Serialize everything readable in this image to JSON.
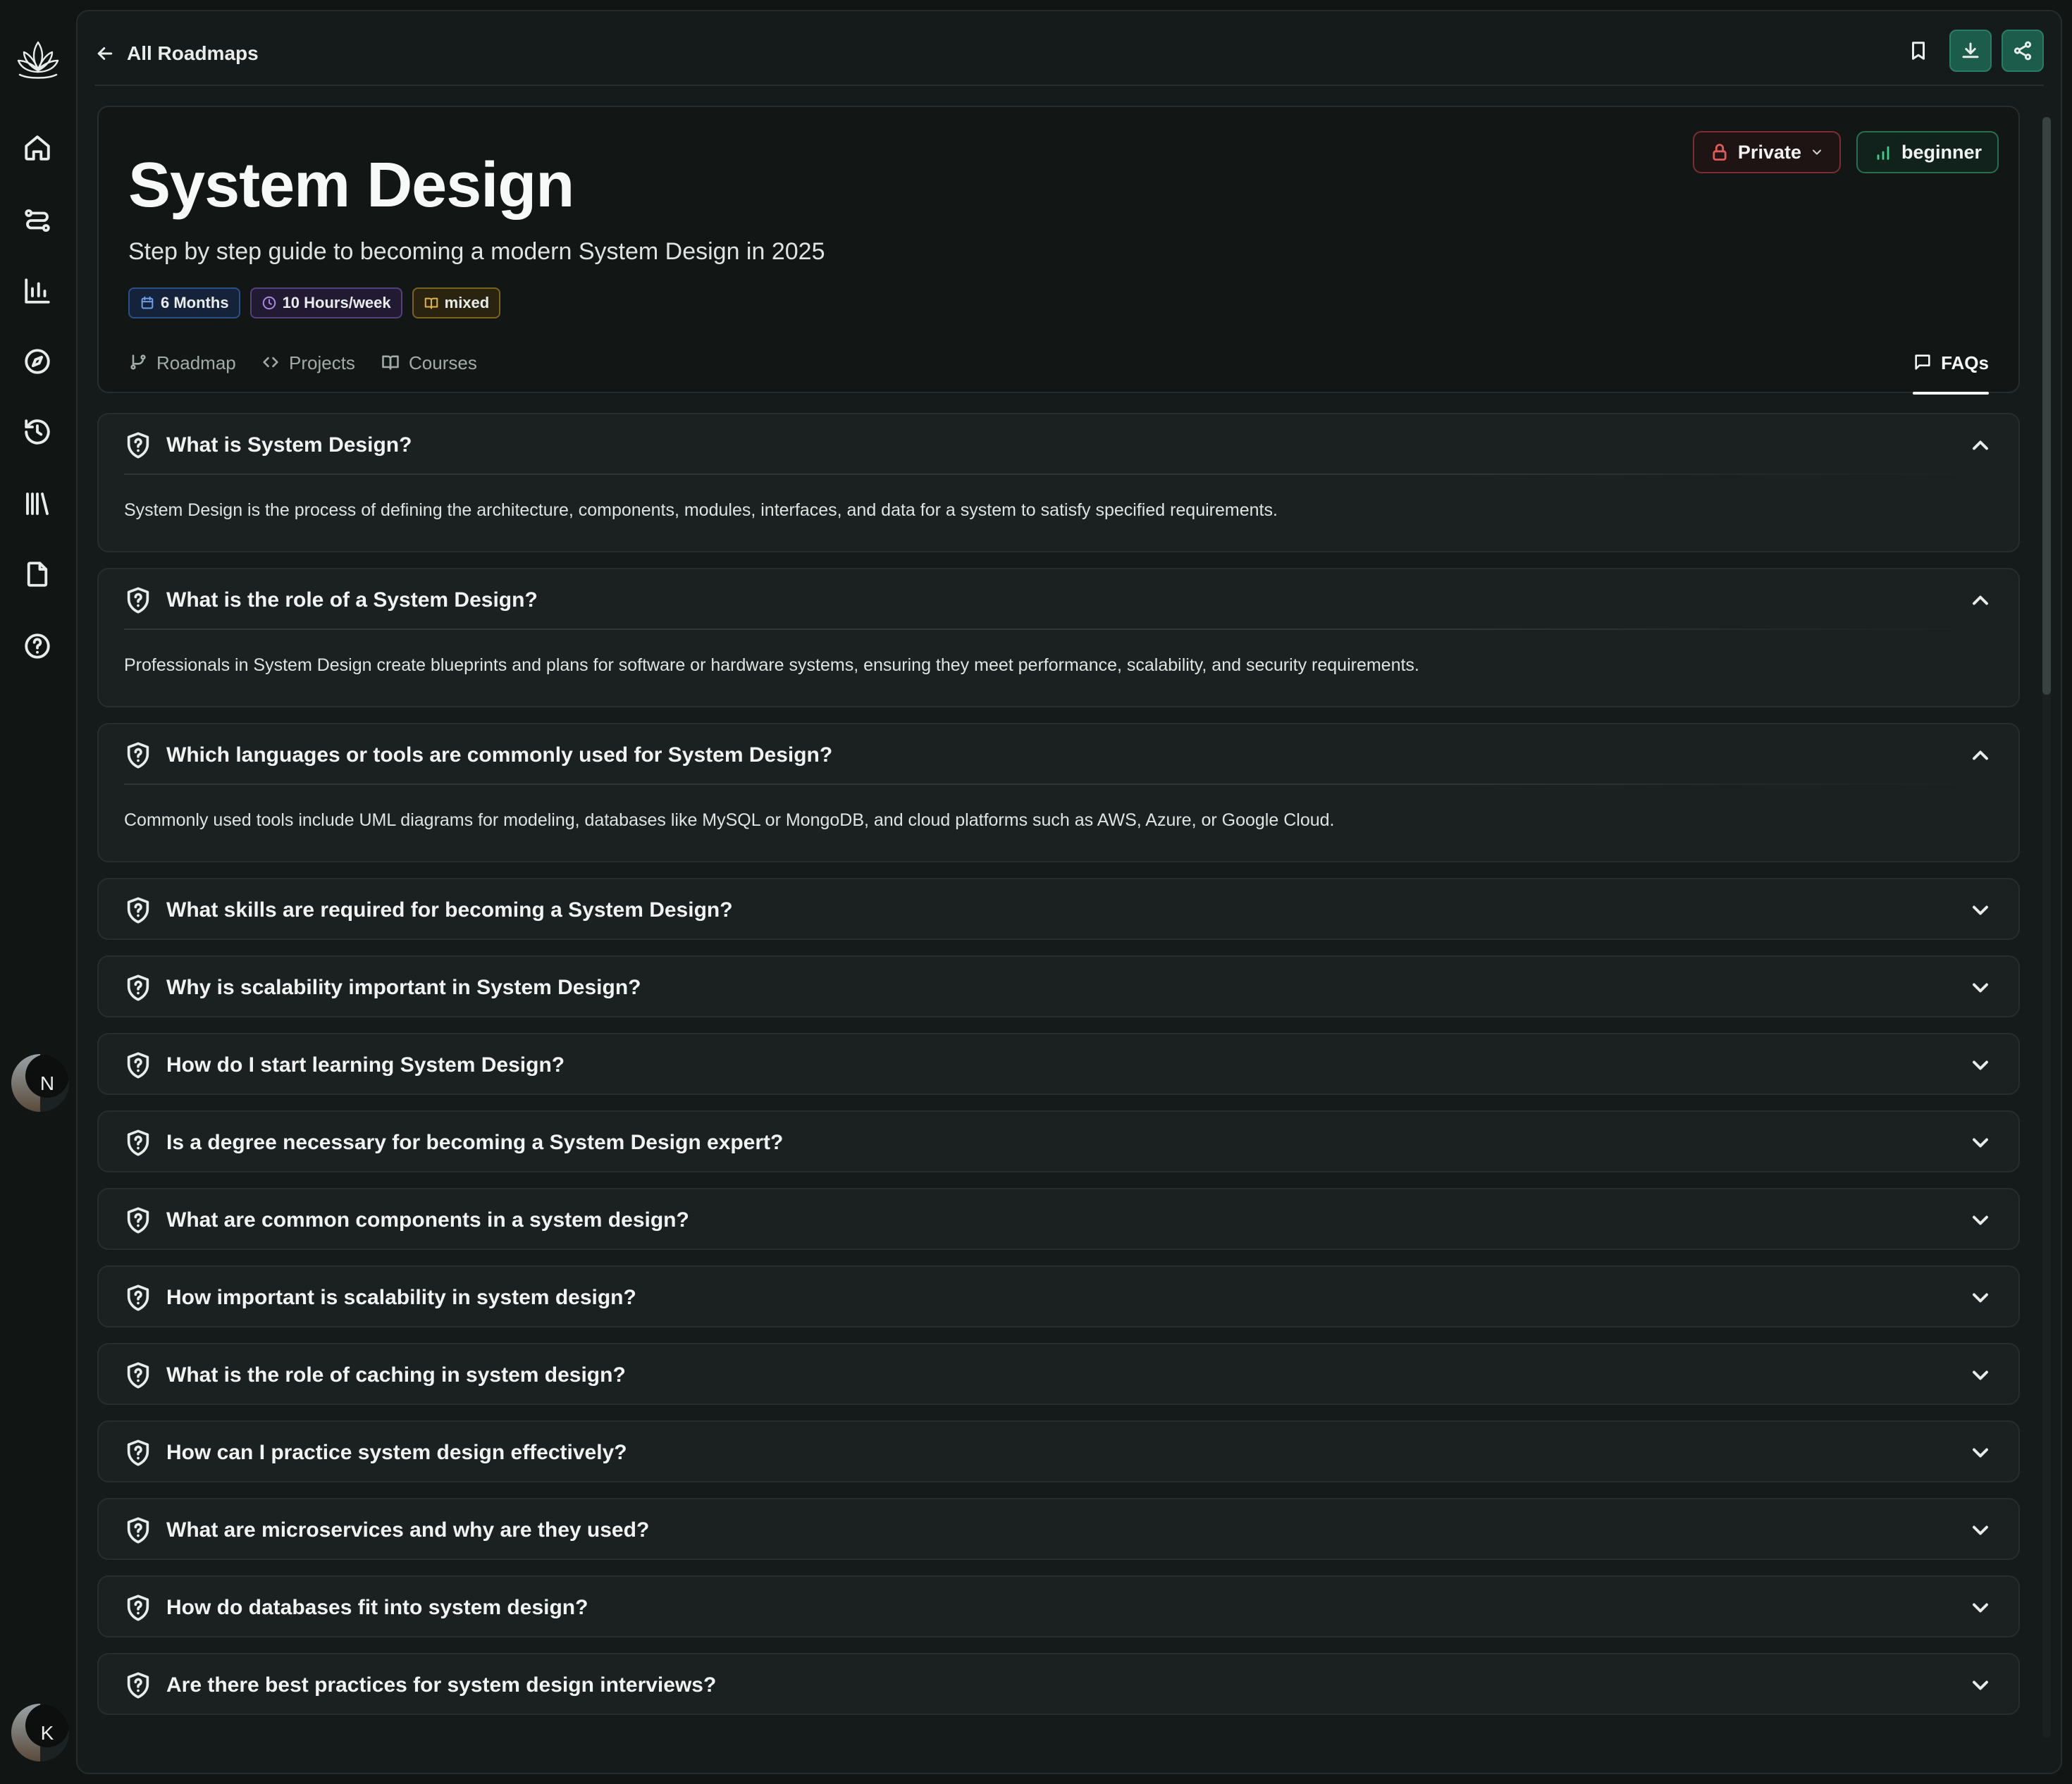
{
  "nav": {
    "back_label": "All Roadmaps"
  },
  "header": {
    "title": "System Design",
    "subtitle": "Step by step guide to becoming a modern System Design in 2025",
    "chips": {
      "duration": "6 Months",
      "hours": "10 Hours/week",
      "mode": "mixed"
    },
    "visibility": "Private",
    "level": "beginner"
  },
  "tabs": {
    "roadmap": "Roadmap",
    "projects": "Projects",
    "courses": "Courses",
    "faqs": "FAQs"
  },
  "faqs": [
    {
      "question": "What is System Design?",
      "answer": "System Design is the process of defining the architecture, components, modules, interfaces, and data for a system to satisfy specified requirements."
    },
    {
      "question": "What is the role of a System Design?",
      "answer": "Professionals in System Design create blueprints and plans for software or hardware systems, ensuring they meet performance, scalability, and security requirements."
    },
    {
      "question": "Which languages or tools are commonly used for System Design?",
      "answer": "Commonly used tools include UML diagrams for modeling, databases like MySQL or MongoDB, and cloud platforms such as AWS, Azure, or Google Cloud."
    },
    {
      "question": "What skills are required for becoming a System Design?"
    },
    {
      "question": "Why is scalability important in System Design?"
    },
    {
      "question": "How do I start learning System Design?"
    },
    {
      "question": "Is a degree necessary for becoming a System Design expert?"
    },
    {
      "question": "What are common components in a system design?"
    },
    {
      "question": "How important is scalability in system design?"
    },
    {
      "question": "What is the role of caching in system design?"
    },
    {
      "question": "How can I practice system design effectively?"
    },
    {
      "question": "What are microservices and why are they used?"
    },
    {
      "question": "How do databases fit into system design?"
    },
    {
      "question": "Are there best practices for system design interviews?"
    }
  ],
  "user": {
    "initial_1": "N",
    "initial_2": "K"
  },
  "colors": {
    "accent_green": "#1c5c4a",
    "private_red": "#e05a5a",
    "level_green": "#3fcf8e"
  }
}
